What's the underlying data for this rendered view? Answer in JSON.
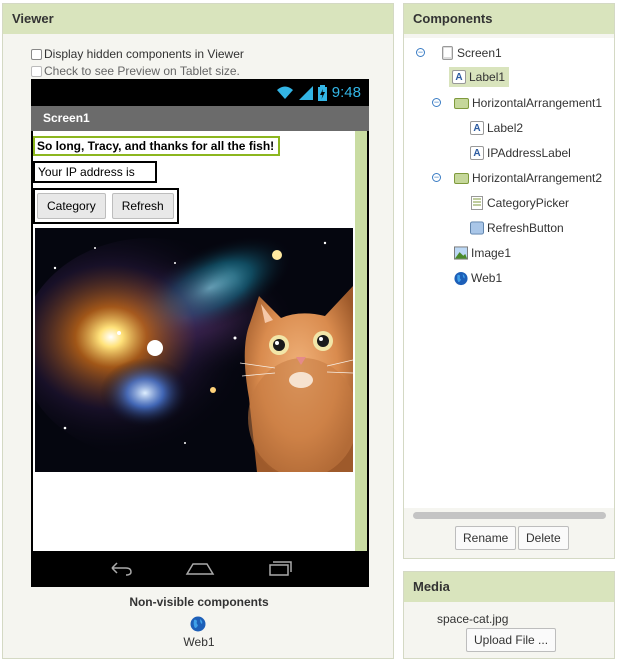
{
  "viewer": {
    "title": "Viewer",
    "display_hidden_label": "Display hidden components in Viewer",
    "tablet_preview_label": "Check to see Preview on Tablet size.",
    "phone": {
      "status_time": "9:48",
      "screen_title": "Screen1",
      "label1_text": "So long, Tracy, and thanks for all the fish!",
      "label2_text": "Your IP address is",
      "category_button": "Category",
      "refresh_button": "Refresh",
      "image_name": "space-cat.jpg"
    },
    "nonvisible_title": "Non-visible components",
    "nonvisible_items": [
      "Web1"
    ]
  },
  "components": {
    "title": "Components",
    "tree": [
      {
        "label": "Screen1",
        "icon": "screen-icon",
        "depth": 0
      },
      {
        "label": "Label1",
        "icon": "label-icon",
        "depth": 1,
        "selected": true
      },
      {
        "label": "HorizontalArrangement1",
        "icon": "arrangement-icon",
        "depth": 1
      },
      {
        "label": "Label2",
        "icon": "label-icon",
        "depth": 2
      },
      {
        "label": "IPAddressLabel",
        "icon": "label-icon",
        "depth": 2
      },
      {
        "label": "HorizontalArrangement2",
        "icon": "arrangement-icon",
        "depth": 1
      },
      {
        "label": "CategoryPicker",
        "icon": "listpicker-icon",
        "depth": 2
      },
      {
        "label": "RefreshButton",
        "icon": "button-icon",
        "depth": 2
      },
      {
        "label": "Image1",
        "icon": "image-icon",
        "depth": 1
      },
      {
        "label": "Web1",
        "icon": "web-globe-icon",
        "depth": 1
      }
    ],
    "rename_button": "Rename",
    "delete_button": "Delete"
  },
  "media": {
    "title": "Media",
    "files": [
      "space-cat.jpg"
    ],
    "upload_button": "Upload File ..."
  },
  "colors": {
    "header_bg": "#d9e4bd",
    "selection_border": "#8cb61f",
    "status_accent": "#33b5e5"
  }
}
